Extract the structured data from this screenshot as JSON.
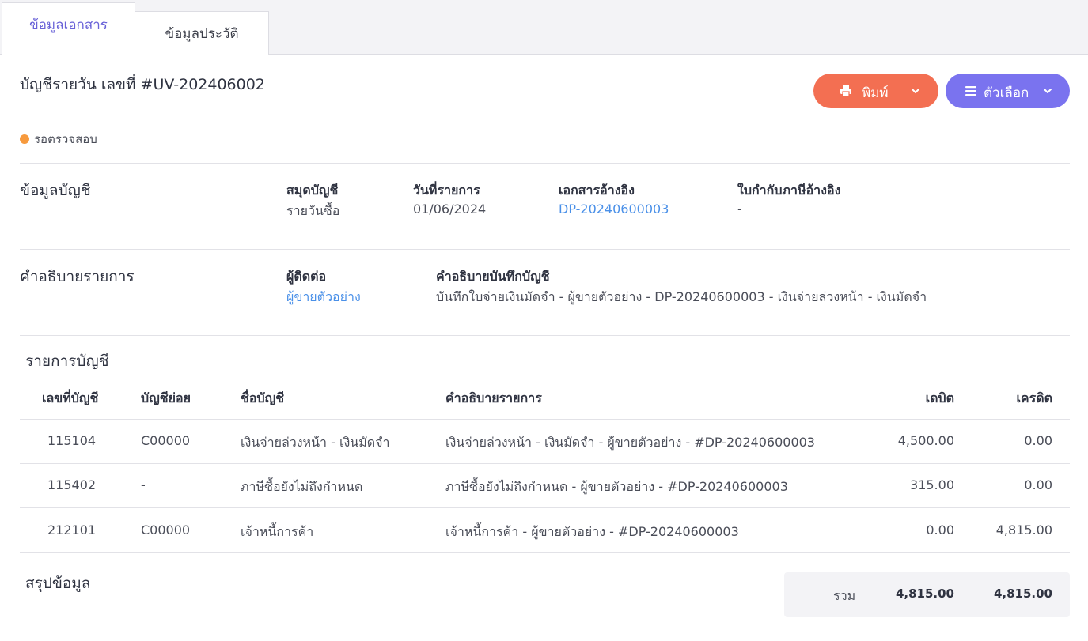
{
  "tabs": [
    {
      "label": "ข้อมูลเอกสาร",
      "active": true
    },
    {
      "label": "ข้อมูลประวัติ",
      "active": false
    }
  ],
  "header": {
    "title": "บัญชีรายวัน เลขที่ #UV-202406002",
    "status": "รอตรวจสอบ",
    "status_color": "#f79a3d"
  },
  "toolbar": {
    "print_label": "พิมพ์",
    "print_color": "#f36f52",
    "options_label": "ตัวเลือก",
    "options_color": "#7a73ef"
  },
  "account_info": {
    "section_title": "ข้อมูลบัญชี",
    "journal_label": "สมุดบัญชี",
    "journal_value": "รายวันซื้อ",
    "date_label": "วันที่รายการ",
    "date_value": "01/06/2024",
    "ref_doc_label": "เอกสารอ้างอิง",
    "ref_doc_value": "DP-20240600003",
    "tax_invoice_label": "ใบกำกับภาษีอ้างอิง",
    "tax_invoice_value": "-"
  },
  "description": {
    "section_title": "คำอธิบายรายการ",
    "contact_label": "ผู้ติดต่อ",
    "contact_value": "ผู้ขายตัวอย่าง",
    "note_label": "คำอธิบายบันทึกบัญชี",
    "note_value": "บันทึกใบจ่ายเงินมัดจำ - ผู้ขายตัวอย่าง - DP-20240600003 - เงินจ่ายล่วงหน้า - เงินมัดจำ"
  },
  "entries": {
    "section_title": "รายการบัญชี",
    "columns": [
      "เลขที่บัญชี",
      "บัญชีย่อย",
      "ชื่อบัญชี",
      "คำอธิบายรายการ",
      "เดบิต",
      "เครดิต"
    ],
    "rows": [
      [
        "115104",
        "C00000",
        "เงินจ่ายล่วงหน้า - เงินมัดจำ",
        "เงินจ่ายล่วงหน้า - เงินมัดจำ - ผู้ขายตัวอย่าง - #DP-20240600003",
        "4,500.00",
        "0.00"
      ],
      [
        "115402",
        "-",
        "ภาษีซื้อยังไม่ถึงกำหนด",
        "ภาษีซื้อยังไม่ถึงกำหนด - ผู้ขายตัวอย่าง - #DP-20240600003",
        "315.00",
        "0.00"
      ],
      [
        "212101",
        "C00000",
        "เจ้าหนี้การค้า",
        "เจ้าหนี้การค้า - ผู้ขายตัวอย่าง - #DP-20240600003",
        "0.00",
        "4,815.00"
      ]
    ]
  },
  "summary": {
    "section_title": "สรุปข้อมูล",
    "total_label": "รวม",
    "total_debit": "4,815.00",
    "total_credit": "4,815.00"
  },
  "accent_color": "#6a63d8",
  "link_color": "#4a90e8"
}
